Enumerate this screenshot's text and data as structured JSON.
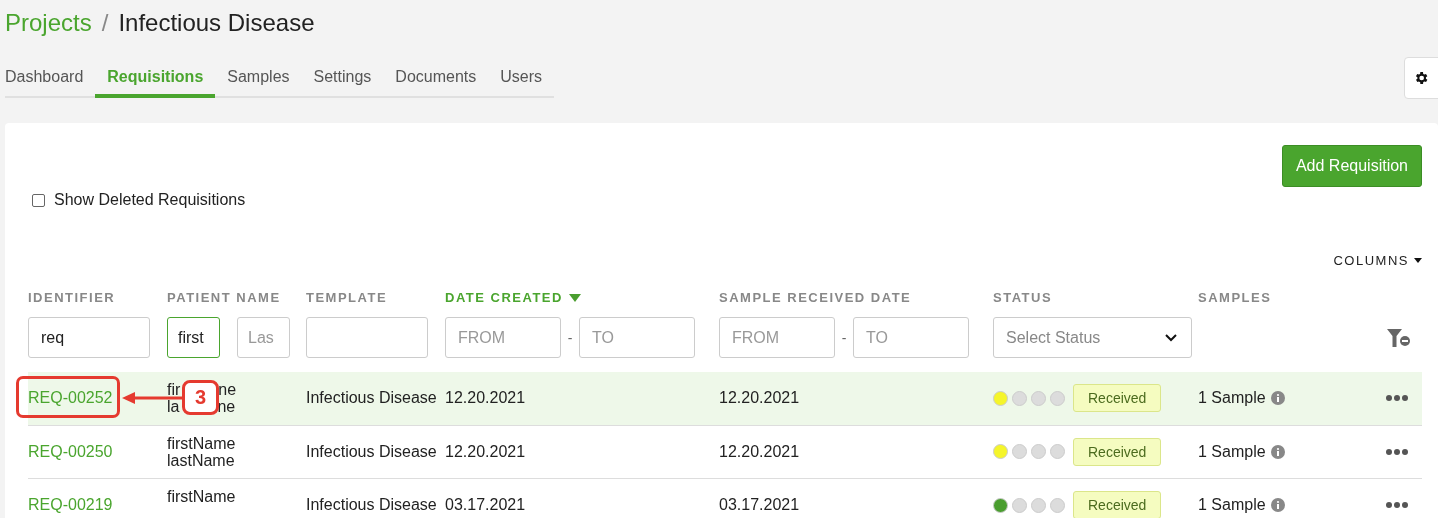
{
  "breadcrumb": {
    "parent": "Projects",
    "separator": "/",
    "current": "Infectious Disease"
  },
  "tabs": [
    {
      "label": "Dashboard",
      "selected": false
    },
    {
      "label": "Requisitions",
      "selected": true
    },
    {
      "label": "Samples",
      "selected": false
    },
    {
      "label": "Settings",
      "selected": false
    },
    {
      "label": "Documents",
      "selected": false
    },
    {
      "label": "Users",
      "selected": false
    }
  ],
  "add_button": "Add Requisition",
  "show_deleted": {
    "label": "Show Deleted Requisitions",
    "checked": false
  },
  "columns_menu": "COLUMNS",
  "table": {
    "columns": [
      {
        "label": "IDENTIFIER",
        "sorted": false
      },
      {
        "label": "PATIENT NAME",
        "sorted": false
      },
      {
        "label": "TEMPLATE",
        "sorted": false
      },
      {
        "label": "DATE CREATED",
        "sorted": true
      },
      {
        "label": "SAMPLE RECEIVED DATE",
        "sorted": false
      },
      {
        "label": "STATUS",
        "sorted": false
      },
      {
        "label": "SAMPLES",
        "sorted": false
      }
    ],
    "filters": {
      "identifier": {
        "value": "req"
      },
      "first_name": {
        "value": "first",
        "focused": true
      },
      "last_name": {
        "placeholder": "Las"
      },
      "date_created": {
        "from": {
          "placeholder": "FROM"
        },
        "dash": "-",
        "to": {
          "placeholder": "TO"
        }
      },
      "sample_received": {
        "from": {
          "placeholder": "FROM"
        },
        "dash": "-",
        "to": {
          "placeholder": "TO"
        }
      },
      "status": {
        "placeholder": "Select Status"
      }
    },
    "rows": [
      {
        "identifier": "REQ-00252",
        "name_lines": [
          [
            "fir",
            "ne"
          ],
          [
            "la",
            "ne"
          ]
        ],
        "template": "Infectious Disease",
        "date_created": "12.20.2021",
        "sample_received": "12.20.2021",
        "steps": [
          {
            "color": "#f5f52a"
          },
          {
            "color": "#dcdcdc"
          },
          {
            "color": "#dcdcdc"
          },
          {
            "color": "#dcdcdc"
          }
        ],
        "status": "Received",
        "samples": "1 Sample",
        "selected": true
      },
      {
        "identifier": "REQ-00250",
        "name_lines": [
          [
            "firstName"
          ],
          [
            "lastName"
          ]
        ],
        "template": "Infectious Disease",
        "date_created": "12.20.2021",
        "sample_received": "12.20.2021",
        "steps": [
          {
            "color": "#f5f52a"
          },
          {
            "color": "#dcdcdc"
          },
          {
            "color": "#dcdcdc"
          },
          {
            "color": "#dcdcdc"
          }
        ],
        "status": "Received",
        "samples": "1 Sample",
        "selected": false
      },
      {
        "identifier": "REQ-00219",
        "name_lines": [
          [
            "firstName"
          ]
        ],
        "template": "Infectious Disease",
        "date_created": "03.17.2021",
        "sample_received": "03.17.2021",
        "steps": [
          {
            "color": "#4a9e2f"
          },
          {
            "color": "#dcdcdc"
          },
          {
            "color": "#dcdcdc"
          },
          {
            "color": "#dcdcdc"
          }
        ],
        "status": "Received",
        "samples": "1 Sample",
        "selected": false
      }
    ]
  },
  "annotation": {
    "number": "3"
  }
}
